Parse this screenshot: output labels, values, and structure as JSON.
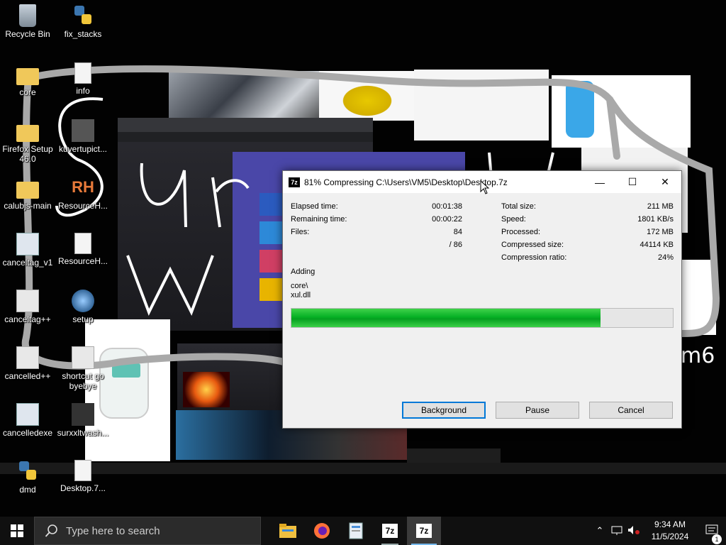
{
  "desktop": {
    "icons": [
      {
        "name": "recycle-bin",
        "label": "Recycle Bin"
      },
      {
        "name": "fix-stacks",
        "label": "fix_stacks"
      },
      {
        "name": "core",
        "label": "core"
      },
      {
        "name": "info",
        "label": "info"
      },
      {
        "name": "firefox-setup",
        "label": "Firefox Setup 46.0"
      },
      {
        "name": "kuvertupict",
        "label": "kuvertupict..."
      },
      {
        "name": "calubjs-main",
        "label": "calubjs-main"
      },
      {
        "name": "resourceh-1",
        "label": "ResourceH..."
      },
      {
        "name": "canceltag-v1",
        "label": "canceltag_v1"
      },
      {
        "name": "resourceh-2",
        "label": "ResourceH..."
      },
      {
        "name": "canceltag-pp",
        "label": "canceltag++"
      },
      {
        "name": "setup",
        "label": "setup"
      },
      {
        "name": "cancelled-pp",
        "label": "cancelled++"
      },
      {
        "name": "shortcut-go-byebye",
        "label": "shortcut go byebye"
      },
      {
        "name": "cancelledexe",
        "label": "cancelledexe"
      },
      {
        "name": "surxxltwash",
        "label": "surxxltwash..."
      },
      {
        "name": "dmd",
        "label": "dmd"
      },
      {
        "name": "desktop-7z",
        "label": "Desktop.7..."
      }
    ]
  },
  "dialog": {
    "title": "81% Compressing C:\\Users\\VM5\\Desktop\\Desktop.7z",
    "icon_text": "7z",
    "progress_percent": 81,
    "left": [
      {
        "k": "Elapsed time:",
        "v": "00:01:38"
      },
      {
        "k": "Remaining time:",
        "v": "00:00:22"
      },
      {
        "k": "Files:",
        "v": "84"
      },
      {
        "k": "",
        "v": "/ 86"
      }
    ],
    "right": [
      {
        "k": "Total size:",
        "v": "211 MB"
      },
      {
        "k": "Speed:",
        "v": "1801 KB/s"
      },
      {
        "k": "Processed:",
        "v": "172 MB"
      },
      {
        "k": "Compressed size:",
        "v": "44114 KB"
      },
      {
        "k": "Compression ratio:",
        "v": "24%"
      }
    ],
    "action": "Adding",
    "path_dir": "core\\",
    "path_file": "xul.dll",
    "buttons": {
      "background": "Background",
      "pause": "Pause",
      "cancel": "Cancel"
    },
    "controls": {
      "minimize": "—",
      "maximize": "☐",
      "close": "✕"
    }
  },
  "taskbar": {
    "search_placeholder": "Type here to search",
    "time": "9:34 AM",
    "date": "11/5/2024",
    "notification_count": "1",
    "apps": [
      {
        "name": "file-explorer",
        "icon": "folder-icon"
      },
      {
        "name": "firefox",
        "icon": "firefox-icon"
      },
      {
        "name": "notepad-doc",
        "icon": "document-icon"
      },
      {
        "name": "7zip-1",
        "icon": "7zip-icon"
      },
      {
        "name": "7zip-2",
        "icon": "7zip-icon"
      }
    ],
    "icon_7z": "7z"
  },
  "colors": {
    "accent": "#0078d7",
    "progress": "#06b025",
    "taskbar": "#101010"
  }
}
